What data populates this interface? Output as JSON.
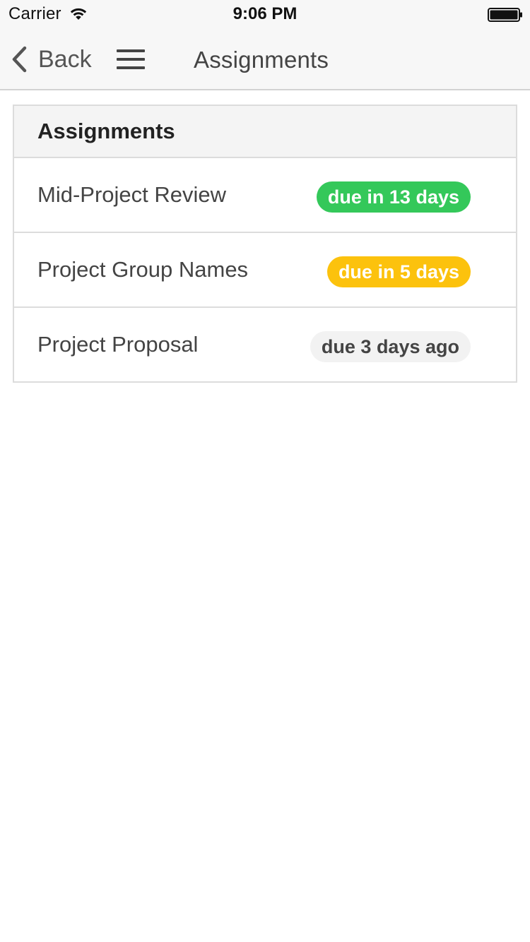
{
  "status_bar": {
    "carrier": "Carrier",
    "time": "9:06 PM",
    "wifi_icon": "wifi-icon",
    "battery_icon": "battery-icon"
  },
  "nav_bar": {
    "back_label": "Back",
    "back_icon": "chevron-left-icon",
    "menu_icon": "hamburger-menu-icon",
    "title": "Assignments"
  },
  "panel": {
    "title": "Assignments",
    "assignments": [
      {
        "name": "Mid-Project Review",
        "due": "due in 13 days",
        "badge_bg": "#34c85a",
        "badge_fg": "#ffffff"
      },
      {
        "name": "Project Group Names",
        "due": "due in 5 days",
        "badge_bg": "#fcc20d",
        "badge_fg": "#ffffff"
      },
      {
        "name": "Project Proposal",
        "due": "due 3 days ago",
        "badge_bg": "#f2f2f2",
        "badge_fg": "#444444"
      }
    ]
  }
}
